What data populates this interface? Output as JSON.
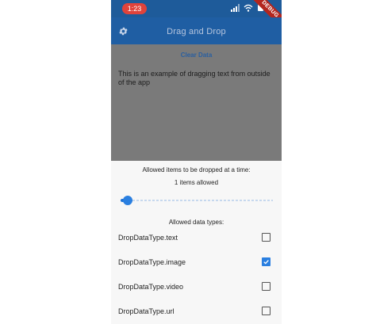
{
  "status_bar": {
    "time": "1:23",
    "ribbon": "DEBUG"
  },
  "app_bar": {
    "title": "Drag and Drop",
    "settings_icon": "gear-icon"
  },
  "content": {
    "clear_label": "Clear Data",
    "example_text": "This is an example of dragging text from outside of the app"
  },
  "sheet": {
    "heading": "Allowed items to be dropped at a time:",
    "items_allowed": "1 items allowed",
    "slider": {
      "value": 1
    },
    "types_heading": "Allowed data types:",
    "types": [
      {
        "label": "DropDataType.text",
        "checked": false
      },
      {
        "label": "DropDataType.image",
        "checked": true
      },
      {
        "label": "DropDataType.video",
        "checked": false
      },
      {
        "label": "DropDataType.url",
        "checked": false
      }
    ]
  },
  "colors": {
    "app_bar": "#1f5ea3",
    "accent": "#2a7fe0",
    "time_pill": "#e0433b"
  }
}
